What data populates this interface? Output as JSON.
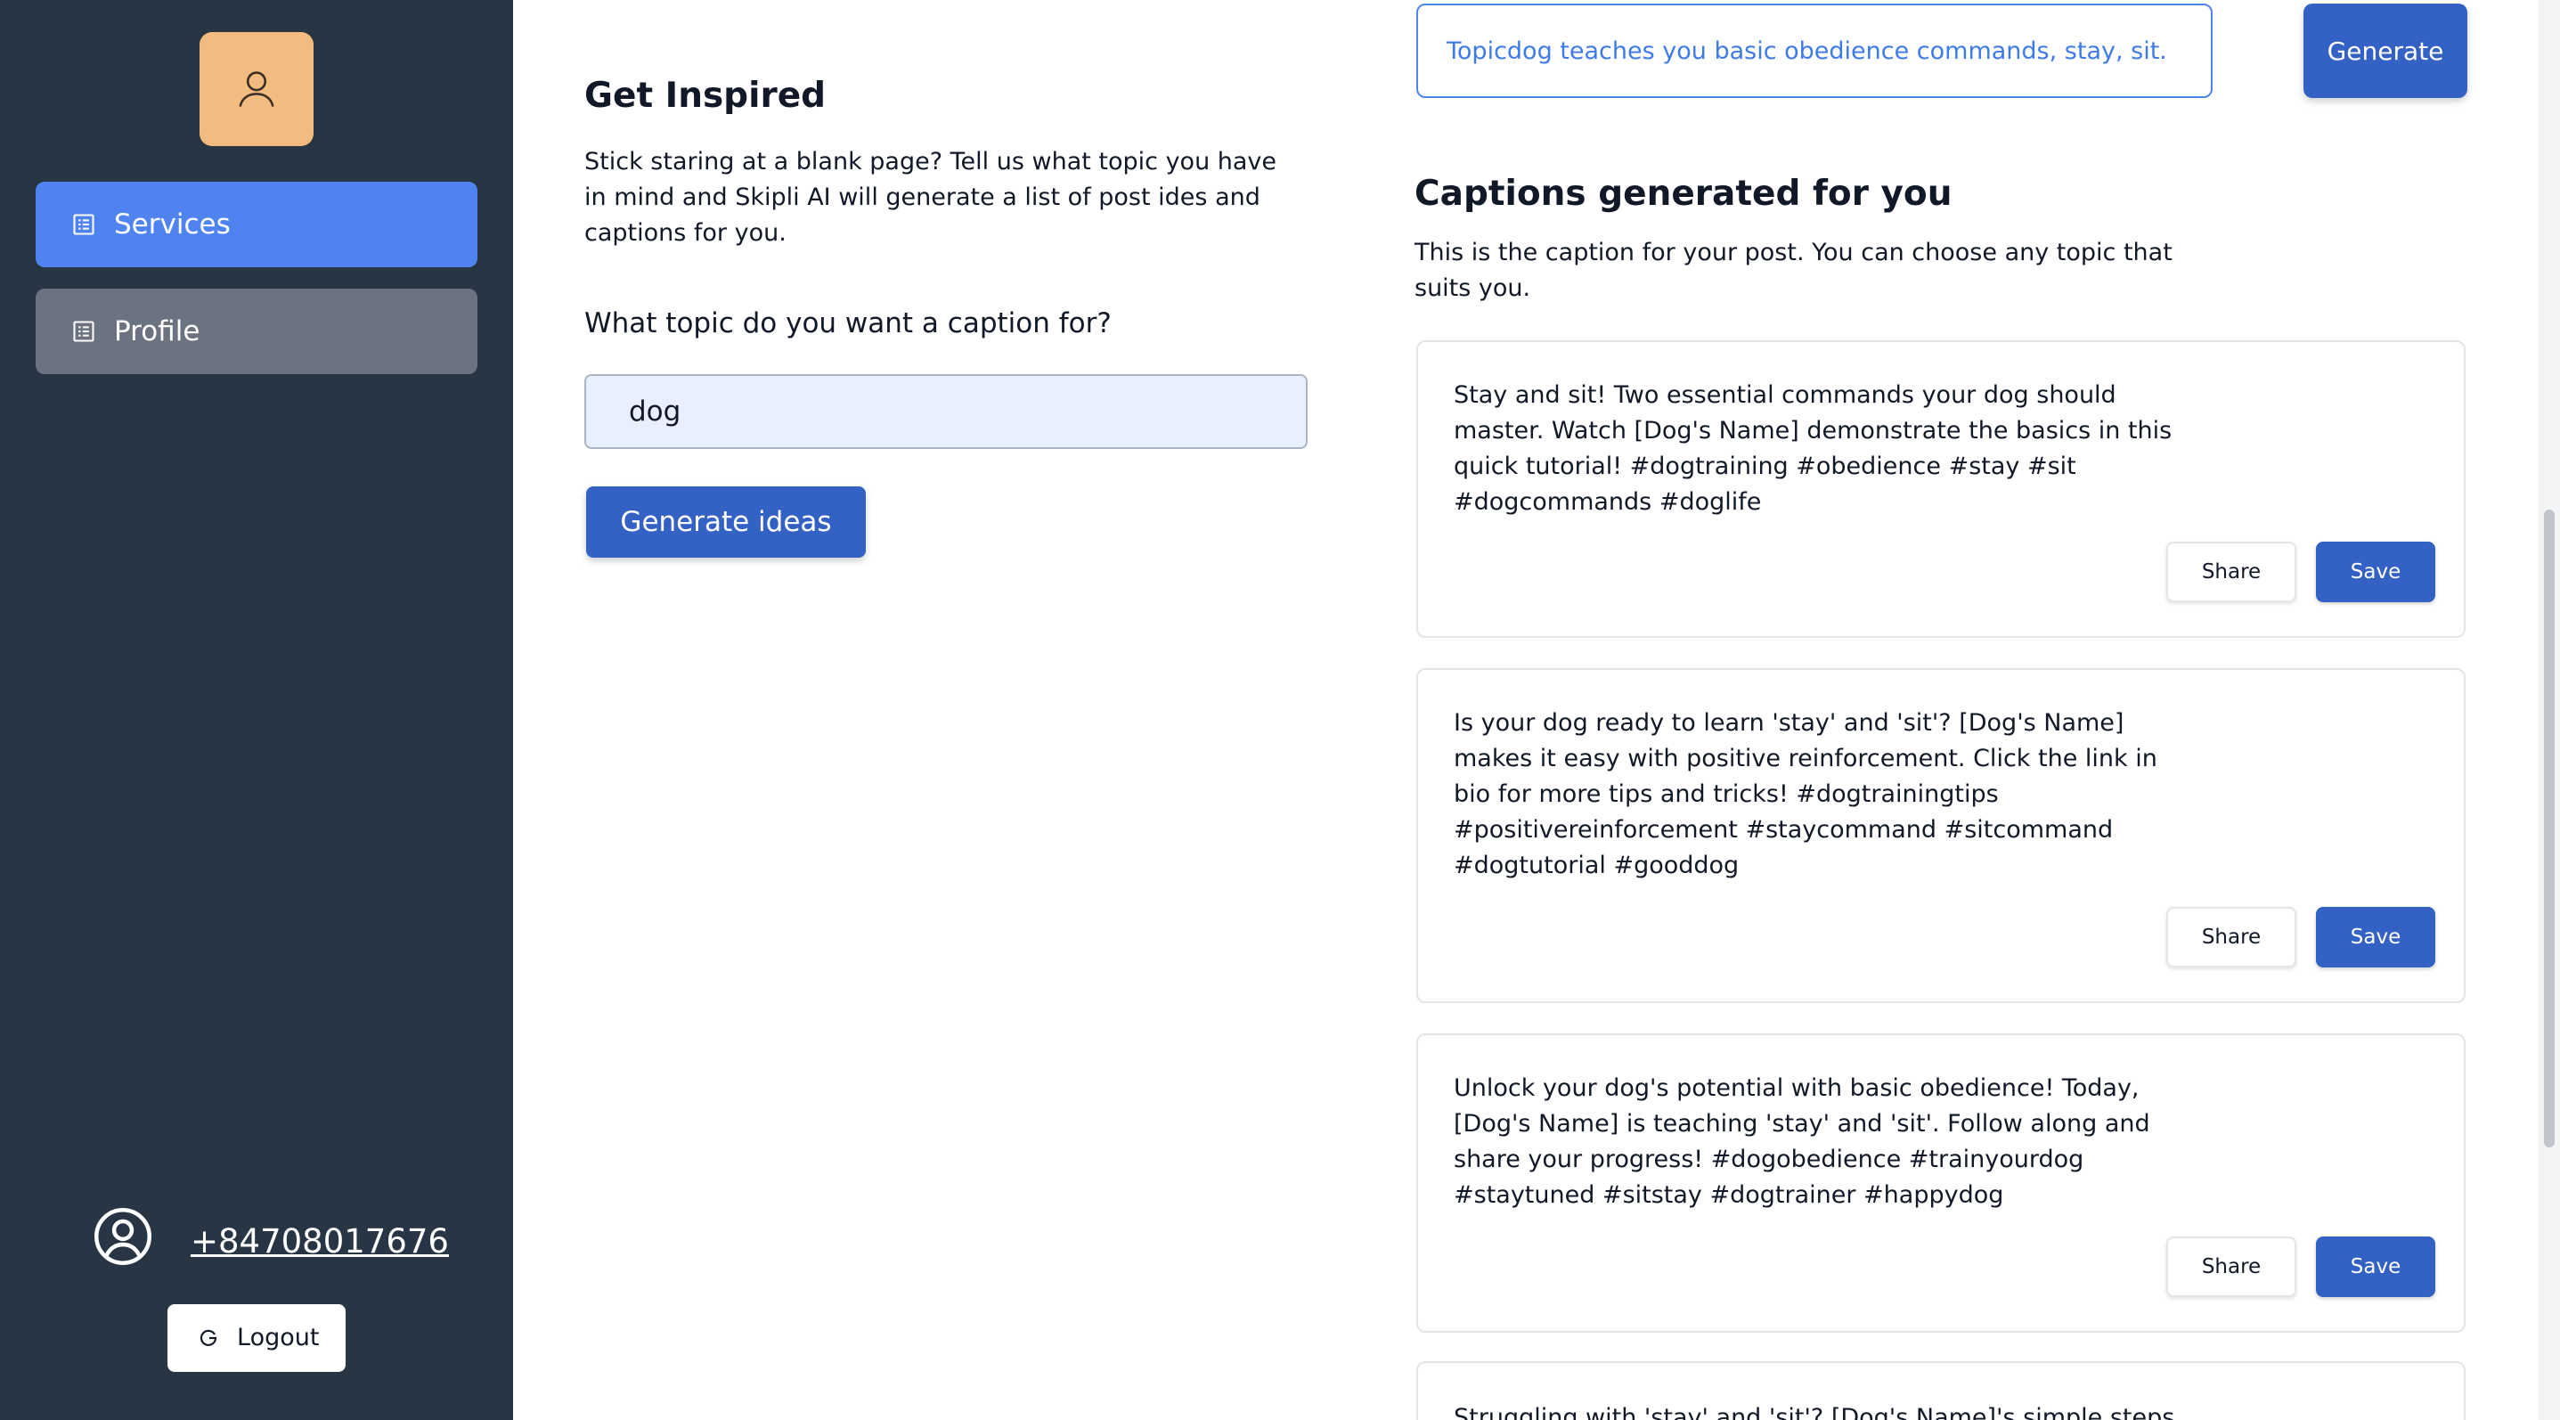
{
  "sidebar": {
    "nav": [
      {
        "label": "Services",
        "icon": "list-icon",
        "active": true
      },
      {
        "label": "Profile",
        "icon": "list-icon",
        "active": false
      }
    ],
    "phone": "+84708017676",
    "logout_label": "Logout"
  },
  "inspire": {
    "heading": "Get Inspired",
    "intro": "Stick staring at a blank page? Tell us what topic you have in mind and Skipli AI will generate a list of post ides and captions for you.",
    "question": "What topic do you want a caption for?",
    "topic_value": "dog",
    "generate_ideas_label": "Generate ideas"
  },
  "captions": {
    "prompt_value": "Topicdog teaches you basic obedience commands, stay, sit.",
    "generate_label": "Generate",
    "title": "Captions generated for you",
    "subtitle": "This is the caption for your post. You can choose any topic that suits you.",
    "share_label": "Share",
    "save_label": "Save",
    "items": [
      {
        "text": "Stay and sit! Two essential commands your dog should master. Watch [Dog's Name] demonstrate the basics in this quick tutorial! #dogtraining #obedience #stay #sit #dogcommands #doglife"
      },
      {
        "text": "Is your dog ready to learn 'stay' and 'sit'? [Dog's Name] makes it easy with positive reinforcement. Click the link in bio for more tips and tricks! #dogtrainingtips #positivereinforcement #staycommand #sitcommand #dogtutorial #gooddog"
      },
      {
        "text": "Unlock your dog's potential with basic obedience! Today, [Dog's Name] is teaching 'stay' and 'sit'. Follow along and share your progress! #dogobedience #trainyourdog #staytuned #sitstay #dogtrainer #happydog"
      },
      {
        "text": "Struggling with 'stay' and 'sit'? [Dog's Name]'s simple steps"
      }
    ]
  },
  "colors": {
    "sidebar_bg": "#283544",
    "active_nav": "#4f84f0",
    "inactive_nav": "#6b7280",
    "avatar_bg": "#f2bb80",
    "primary_button": "#3461c4"
  }
}
